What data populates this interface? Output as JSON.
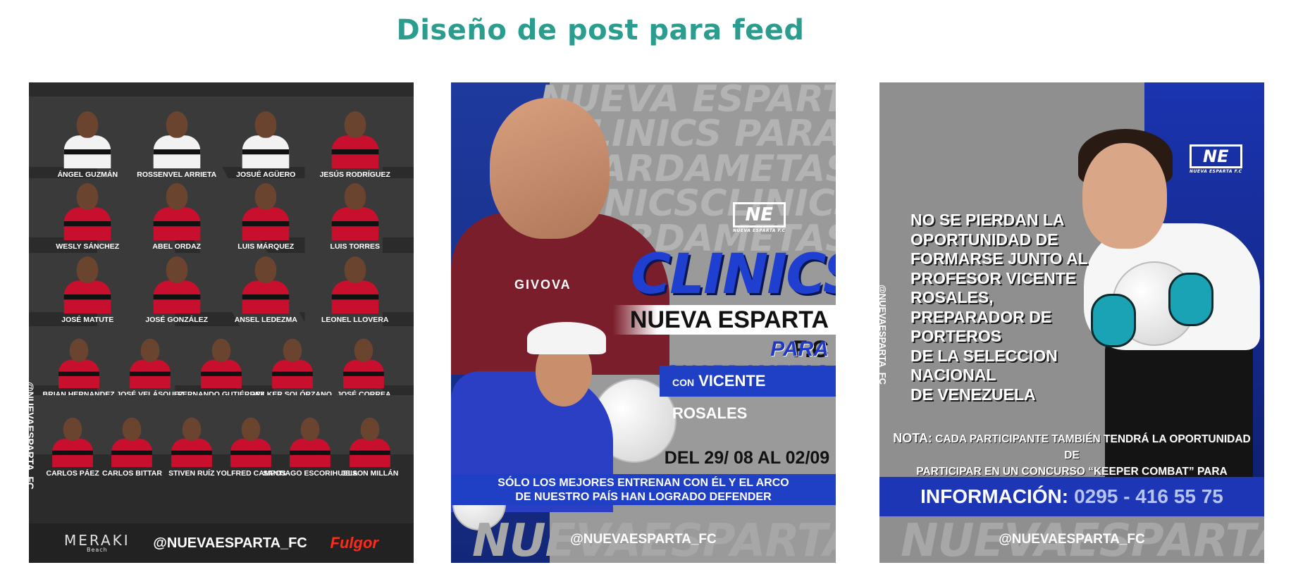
{
  "page_title": "Diseño de post para feed",
  "post1": {
    "side_handle": "@NUEVAESPARTA_FC",
    "rows": [
      [
        {
          "name": "Ángel Guzmán",
          "kit": "white"
        },
        {
          "name": "Rossenvel Arrieta",
          "kit": "white"
        },
        {
          "name": "Josué Agüero",
          "kit": "white"
        },
        {
          "name": "Jesús Rodríguez",
          "kit": "red"
        }
      ],
      [
        {
          "name": "Wesly Sánchez",
          "kit": "red"
        },
        {
          "name": "Abel Ordaz",
          "kit": "red"
        },
        {
          "name": "Luis Márquez",
          "kit": "red"
        },
        {
          "name": "Luis Torres",
          "kit": "red"
        }
      ],
      [
        {
          "name": "José Matute",
          "kit": "red"
        },
        {
          "name": "José González",
          "kit": "red"
        },
        {
          "name": "Ansel Ledezma",
          "kit": "red"
        },
        {
          "name": "Leonel Llovera",
          "kit": "red"
        }
      ],
      [
        {
          "name": "Brian Hernandez",
          "kit": "red"
        },
        {
          "name": "José Velásquez",
          "kit": "red"
        },
        {
          "name": "Fernando Gutiérrez",
          "kit": "red"
        },
        {
          "name": "Wilker Solórzano",
          "kit": "red"
        },
        {
          "name": "José Correa",
          "kit": "red"
        }
      ],
      [
        {
          "name": "Carlos Páez",
          "kit": "red"
        },
        {
          "name": "Carlos Bittar",
          "kit": "red"
        },
        {
          "name": "Stiven Ruíz",
          "kit": "red"
        },
        {
          "name": "Yolfred Campos",
          "kit": "red"
        },
        {
          "name": "Santiago Escorihuela",
          "kit": "red"
        },
        {
          "name": "Jeison Millán",
          "kit": "red"
        }
      ]
    ],
    "footer": {
      "sponsor_left": "MERAKI",
      "sponsor_left_sub": "Beach",
      "handle": "@NUEVAESPARTA_FC",
      "sponsor_right": "Fulgor"
    }
  },
  "post2": {
    "bg_words": [
      "NUEVA ESPARTA",
      "CLINICS PARA",
      "GUARDAMETAS",
      "CLINICSCLINICS",
      "GUARDAMETAS"
    ],
    "coach_brand": "GIVOVA",
    "logo_mark": "NE",
    "logo_sub": "NUEVA ESPARTA F.C",
    "title": "CLINICS",
    "club": "NUEVA ESPARTA F.C",
    "subtitle": "PARA GUARDAMETAS",
    "with_prefix": "CON",
    "with_name": "VICENTE ROSALES",
    "dates": "DEL 29/ 08 AL 02/09",
    "banner_line1": "SÓLO LOS MEJORES  ENTRENAN CON ÉL Y EL ARCO",
    "banner_line2": "DE NUESTRO PAÍS HAN LOGRADO DEFENDER",
    "watermark": "NUEVAESPARTA F.C",
    "handle": "@NUEVAESPARTA_FC"
  },
  "post3": {
    "logo_mark": "NE",
    "logo_sub": "NUEVA ESPARTA F.C",
    "side_handle": "@NUEVAESPARTA_FC",
    "message_lines": [
      "NO SE PIERDAN LA",
      "OPORTUNIDAD DE",
      "FORMARSE JUNTO AL",
      "PROFESOR VICENTE ROSALES,",
      "PREPARADOR DE PORTEROS",
      "DE LA SELECCION NACIONAL",
      "DE VENEZUELA"
    ],
    "nota_label": "NOTA:",
    "nota_line1": "CADA PARTICIPANTE TAMBIÉN TENDRÁ LA OPORTUNIDAD DE",
    "nota_line2": "PARTICIPAR  EN UN CONCURSO “KEEPER COMBAT” PARA CERRAR EL EVENTO",
    "info_label": "INFORMACIÓN:",
    "info_phone": "0295 - 416 55 75",
    "watermark": "NUEVAESPARTA F.C",
    "handle": "@NUEVAESPARTA_FC"
  },
  "colors": {
    "title": "#2a9d8f",
    "club_blue": "#1f3fc4",
    "kit_red": "#c8102e"
  }
}
